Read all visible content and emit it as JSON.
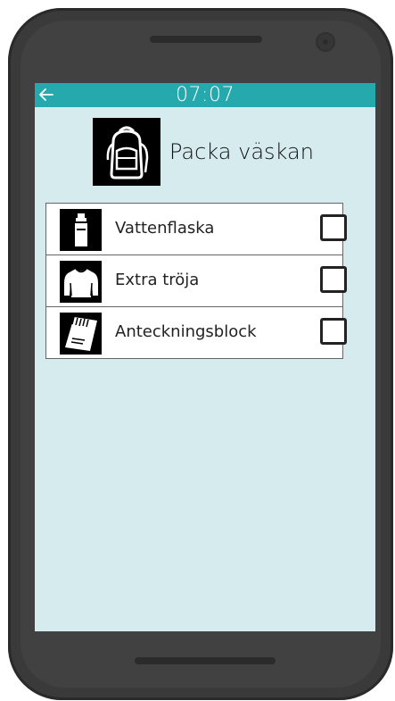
{
  "status_bar": {
    "time": "07:07",
    "color": "#26a9ad",
    "back_icon": "arrow-left-icon"
  },
  "header": {
    "title": "Packa väskan",
    "icon": "backpack-icon"
  },
  "checklist": {
    "items": [
      {
        "label": "Vattenflaska",
        "icon": "water-bottle-icon",
        "checked": false
      },
      {
        "label": "Extra tröja",
        "icon": "sweater-icon",
        "checked": false
      },
      {
        "label": "Anteckningsblock",
        "icon": "notebook-icon",
        "checked": false
      }
    ]
  },
  "colors": {
    "screen_background": "#d6ebee",
    "phone_body": "#3a3a3a"
  }
}
